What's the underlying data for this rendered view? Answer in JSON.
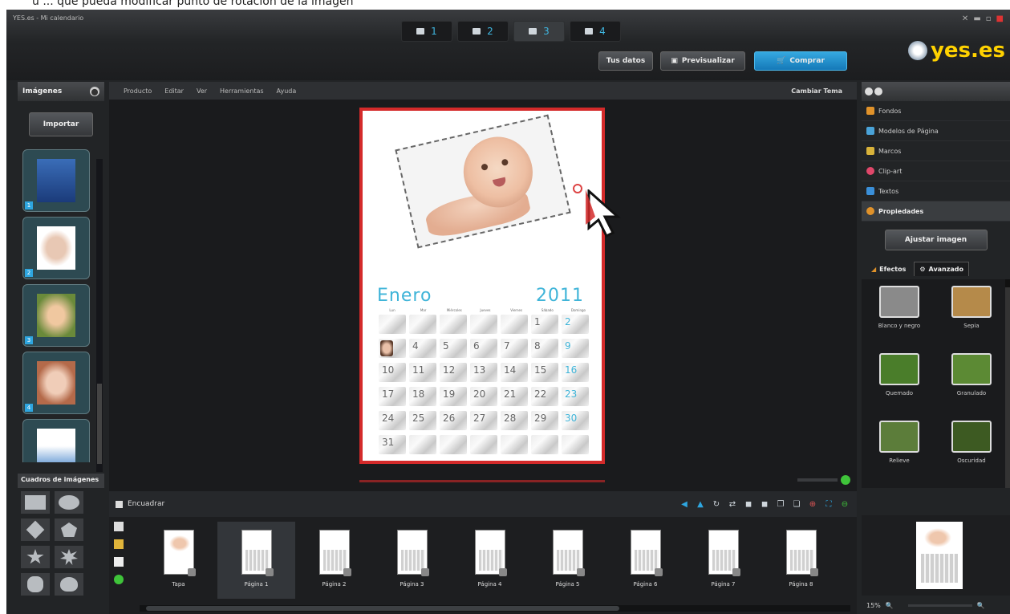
{
  "caption": "u ... que pueda modificar punto de rotación de la imagen",
  "window": {
    "title": "YES.es - Mi calendario"
  },
  "steps": [
    {
      "num": "1",
      "icon": "photo-import-icon"
    },
    {
      "num": "2",
      "icon": "layout-icon"
    },
    {
      "num": "3",
      "icon": "edit-page-icon"
    },
    {
      "num": "4",
      "icon": "cart-icon"
    }
  ],
  "logo": "yes.es",
  "topbar": {
    "tus_datos": "Tus datos",
    "previsualizar": "Previsualizar",
    "comprar": "Comprar"
  },
  "left_panel": {
    "title": "Imágenes",
    "import": "Importar",
    "thumb_numbers": [
      "1",
      "2",
      "3",
      "4",
      "5"
    ],
    "shapes_title": "Cuadros de imágenes"
  },
  "menu": [
    "Producto",
    "Editar",
    "Ver",
    "Herramientas",
    "Ayuda"
  ],
  "cambiar_tema": "Cambiar Tema",
  "calendar": {
    "month": "Enero",
    "year": "2011",
    "weekdays": [
      "Lun",
      "Mar",
      "Miércoles",
      "Jueves",
      "Viernes",
      "Sábado",
      "Domingo"
    ],
    "rows": [
      [
        "",
        "",
        "",
        "",
        "",
        "1",
        "2"
      ],
      [
        "3",
        "4",
        "5",
        "6",
        "7",
        "8",
        "9"
      ],
      [
        "10",
        "11",
        "12",
        "13",
        "14",
        "15",
        "16"
      ],
      [
        "17",
        "18",
        "19",
        "20",
        "21",
        "22",
        "23"
      ],
      [
        "24",
        "25",
        "26",
        "27",
        "28",
        "29",
        "30"
      ],
      [
        "31",
        "",
        "",
        "",
        "",
        "",
        ""
      ]
    ]
  },
  "bottom": {
    "encuadrar": "Encuadrar",
    "pages": [
      "Tapa",
      "Página 1",
      "Página 2",
      "Página 3",
      "Página 4",
      "Página 5",
      "Página 6",
      "Página 7",
      "Página 8"
    ],
    "active_page": "Página 1"
  },
  "right_panel": {
    "items": [
      {
        "label": "Fondos",
        "icon": "backgrounds-icon",
        "color": "#e0922a"
      },
      {
        "label": "Modelos de Página",
        "icon": "page-templates-icon",
        "color": "#4aa3d8"
      },
      {
        "label": "Marcos",
        "icon": "frames-icon",
        "color": "#d8b23a"
      },
      {
        "label": "Clip-art",
        "icon": "clipart-heart-icon",
        "color": "#e0476a"
      },
      {
        "label": "Textos",
        "icon": "text-icon",
        "color": "#3a8fd8"
      },
      {
        "label": "Propiedades",
        "icon": "properties-gear-icon",
        "color": "#e0922a"
      }
    ],
    "adjust_button": "Ajustar imagen",
    "tabs": [
      "Efectos",
      "Avanzado"
    ],
    "effects": [
      {
        "label": "Blanco y negro",
        "color": "#8a8a8a"
      },
      {
        "label": "Sepia",
        "color": "#b58a4a"
      },
      {
        "label": "Quemado",
        "color": "#4a7d2a"
      },
      {
        "label": "Granulado",
        "color": "#5c8a34"
      },
      {
        "label": "Relieve",
        "color": "#5c7d3a"
      },
      {
        "label": "Oscuridad",
        "color": "#3d5a22"
      }
    ],
    "zoom_percent": "15%"
  }
}
